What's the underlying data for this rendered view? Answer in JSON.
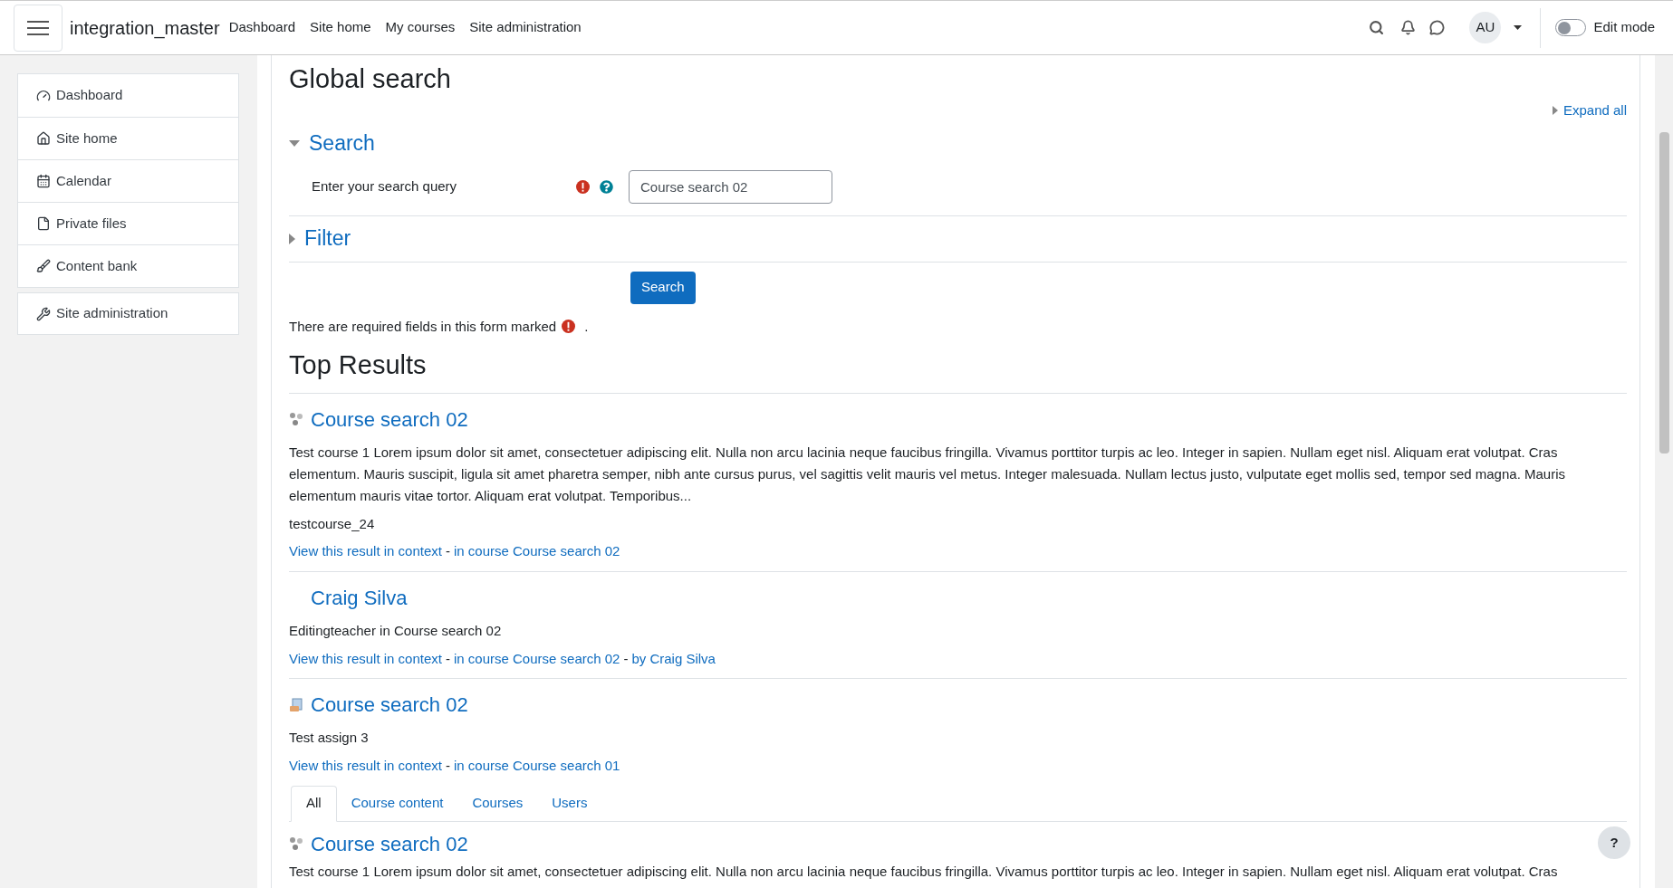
{
  "navbar": {
    "site_name": "integration_master",
    "links": [
      "Dashboard",
      "Site home",
      "My courses",
      "Site administration"
    ],
    "avatar": "AU",
    "edit_mode": {
      "label": "Edit mode",
      "on": false
    }
  },
  "sidebar": {
    "items": [
      {
        "kind": "dashboard",
        "label": "Dashboard"
      },
      {
        "kind": "home",
        "label": "Site home"
      },
      {
        "kind": "calendar",
        "label": "Calendar"
      },
      {
        "kind": "file",
        "label": "Private files"
      },
      {
        "kind": "brush",
        "label": "Content bank"
      }
    ],
    "admin": {
      "kind": "wrench",
      "label": "Site administration"
    }
  },
  "page_title": "Global search",
  "expand_all": "Expand all",
  "sections": [
    {
      "title": "Search",
      "expanded": true
    },
    {
      "title": "Filter",
      "expanded": false
    }
  ],
  "query": {
    "label": "Enter your search query",
    "value": "Course search 02"
  },
  "search_button": "Search",
  "required_note": {
    "before": "There are required fields in this form marked",
    "after": "."
  },
  "top_results_title": "Top Results",
  "top_results": [
    {
      "kind": "course",
      "title": "Course search 02",
      "description": "Test course 1 Lorem ipsum dolor sit amet, consectetuer adipiscing elit. Nulla non arcu lacinia neque faucibus fringilla. Vivamus porttitor turpis ac leo. Integer in sapien. Nullam eget nisl. Aliquam erat volutpat. Cras elementum. Mauris suscipit, ligula sit amet pharetra semper, nibh ante cursus purus, vel sagittis velit mauris vel metus. Integer malesuada. Nullam lectus justo, vulputate eget mollis sed, tempor sed magna. Mauris elementum mauris vitae tortor. Aliquam erat volutpat. Temporibus...",
      "extra": "testcourse_24",
      "links": [
        "View this result in context",
        "in course Course search 02"
      ]
    },
    {
      "kind": "user",
      "title": "Craig Silva",
      "description": "Editingteacher in Course search 02",
      "links": [
        "View this result in context",
        "in course Course search 02",
        "by Craig Silva"
      ]
    },
    {
      "kind": "assign",
      "title": "Course search 02",
      "description": "Test assign 3",
      "links": [
        "View this result in context",
        "in course Course search 01"
      ]
    }
  ],
  "link_separator": "-",
  "tabs": [
    {
      "label": "All",
      "selected": true
    },
    {
      "label": "Course content",
      "selected": false
    },
    {
      "label": "Courses",
      "selected": false
    },
    {
      "label": "Users",
      "selected": false
    }
  ],
  "results": [
    {
      "kind": "course",
      "title": "Course search 02",
      "description": "Test course 1 Lorem ipsum dolor sit amet, consectetuer adipiscing elit. Nulla non arcu lacinia neque faucibus fringilla. Vivamus porttitor turpis ac leo. Integer in sapien. Nullam eget nisl. Aliquam erat volutpat. Cras"
    }
  ],
  "help_button": "?"
}
